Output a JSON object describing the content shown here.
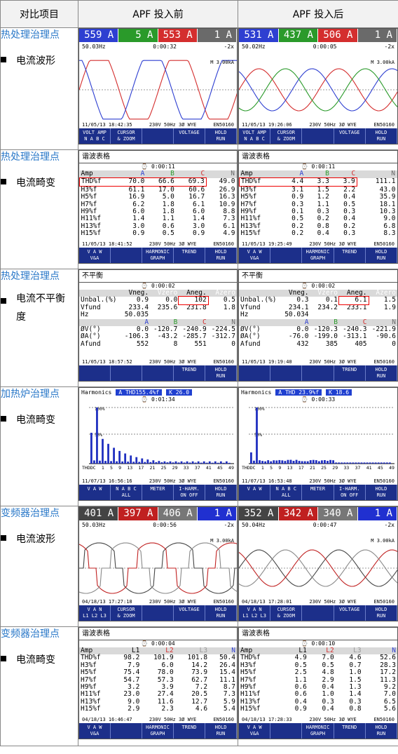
{
  "header": {
    "col1": "对比项目",
    "col2": "APF 投入前",
    "col3": "APF 投入后"
  },
  "rows": [
    {
      "title": "热处理治理点",
      "desc": "电流波形"
    },
    {
      "title": "热处理治理点",
      "desc": "电流畸变"
    },
    {
      "title": "热处理治理点",
      "desc": "电流不平衡度"
    },
    {
      "title": "加热炉治理点",
      "desc": "电流畸变"
    },
    {
      "title": "变频器治理点",
      "desc": "电流波形"
    },
    {
      "title": "变频器治理点",
      "desc": "电流畸变"
    }
  ],
  "wave1": {
    "before": {
      "readings": [
        "559 A",
        "5 A",
        "553 A",
        "1 A"
      ],
      "range": "50.03Hz",
      "time": "0:00:32",
      "scale": "M 3.00kA",
      "date": "11/05/13 18:42:35",
      "sys": "230V 50Hz 3Ø WYE",
      "model": "EN50160",
      "keys": [
        "VOLT AMP\nN A B C",
        "CURSOR\n& ZOOM",
        "",
        "VOLTAGE",
        "HOLD\nRUN"
      ]
    },
    "after": {
      "readings": [
        "531 A",
        "437 A",
        "506 A",
        "1 A"
      ],
      "range": "50.02Hz",
      "time": "0:00:05",
      "scale": "M 3.00kA",
      "date": "11/05/13 19:26:06",
      "sys": "230V 50Hz 3Ø WYE",
      "model": "EN50160",
      "keys": [
        "VOLT AMP\nN A B C",
        "CURSOR\n& ZOOM",
        "",
        "VOLTAGE",
        "HOLD\nRUN"
      ]
    }
  },
  "harm1": {
    "before": {
      "title": "谐波表格",
      "time": "0:00:11",
      "cols": [
        "Amp",
        "A",
        "B",
        "C",
        "N"
      ],
      "rows": [
        [
          "THD%f",
          "70.0",
          "66.6",
          "69.3",
          "49.0"
        ],
        [
          "H3%f",
          "61.1",
          "17.0",
          "60.6",
          "26.9"
        ],
        [
          "H5%f",
          "16.9",
          "5.0",
          "16.7",
          "16.3"
        ],
        [
          "H7%f",
          "6.2",
          "1.8",
          "6.1",
          "10.9"
        ],
        [
          "H9%f",
          "6.0",
          "1.8",
          "6.0",
          "8.8"
        ],
        [
          "H11%f",
          "1.4",
          "1.1",
          "1.4",
          "7.3"
        ],
        [
          "H13%f",
          "3.0",
          "0.6",
          "3.0",
          "6.1"
        ],
        [
          "H15%f",
          "0.9",
          "0.5",
          "0.9",
          "4.9"
        ]
      ],
      "date": "11/05/13 18:41:52",
      "sys": "230V 50Hz 3Ø WYE",
      "model": "EN50160",
      "keys": [
        "V A W\nV&A",
        "",
        "HARMONIC\nGRAPH",
        "TREND",
        "HOLD\nRUN"
      ]
    },
    "after": {
      "title": "谐波表格",
      "time": "0:00:11",
      "cols": [
        "Amp",
        "A",
        "B",
        "C",
        "N"
      ],
      "rows": [
        [
          "THD%f",
          "4.4",
          "3.3",
          "3.9",
          "111.1"
        ],
        [
          "H3%f",
          "3.1",
          "1.5",
          "2.2",
          "43.0"
        ],
        [
          "H5%f",
          "0.9",
          "1.2",
          "0.4",
          "35.9"
        ],
        [
          "H7%f",
          "0.3",
          "1.1",
          "0.5",
          "18.1"
        ],
        [
          "H9%f",
          "0.1",
          "0.3",
          "0.3",
          "10.3"
        ],
        [
          "H11%f",
          "0.5",
          "0.2",
          "0.4",
          "9.0"
        ],
        [
          "H13%f",
          "0.2",
          "0.8",
          "0.2",
          "6.8"
        ],
        [
          "H15%f",
          "0.2",
          "0.4",
          "0.3",
          "8.3"
        ]
      ],
      "date": "11/05/13 19:25:49",
      "sys": "230V 50Hz 3Ø WYE",
      "model": "EN50160",
      "keys": [
        "V A W\nV&A",
        "",
        "HARMONIC\nGRAPH",
        "TREND",
        "HOLD\nRUN"
      ]
    }
  },
  "unbal": {
    "before": {
      "title": "不平衡",
      "time": "0:00:02",
      "head": [
        "",
        "Vneg.",
        "Vzero",
        "Aneg.",
        "Azero"
      ],
      "unbal": [
        "Unbal.(%)",
        "0.9",
        "0.0",
        "102",
        "0.5"
      ],
      "vfund": [
        "Vfund",
        "233.4",
        "235.6",
        "231.8",
        "1.8"
      ],
      "hz": [
        "Hz",
        "50.035"
      ],
      "abc": [
        "",
        "A",
        "B",
        "C",
        "N"
      ],
      "phv": [
        "ØV(°)",
        "0.0",
        "-120.7",
        "-240.9",
        "-224.5"
      ],
      "pha": [
        "ØA(°)",
        "-106.3",
        "-43.2",
        "-285.7",
        "-312.7"
      ],
      "afund": [
        "Afund",
        "552",
        "8",
        "551",
        "0"
      ],
      "date": "11/05/13 18:57:52",
      "sys": "230V 50Hz 3Ø WYE",
      "model": "EN50160",
      "keys": [
        "",
        "",
        "",
        "TREND",
        "HOLD\nRUN"
      ]
    },
    "after": {
      "title": "不平衡",
      "time": "0:00:02",
      "head": [
        "",
        "Vneg.",
        "Vzero",
        "Aneg.",
        "Azero"
      ],
      "unbal": [
        "Unbal.(%)",
        "0.3",
        "0.1",
        "6.1",
        "1.5"
      ],
      "vfund": [
        "Vfund",
        "234.1",
        "234.2",
        "233.1",
        "1.9"
      ],
      "hz": [
        "Hz",
        "50.034"
      ],
      "abc": [
        "",
        "A",
        "B",
        "C",
        "N"
      ],
      "phv": [
        "ØV(°)",
        "0.0",
        "-120.3",
        "-240.3",
        "-221.9"
      ],
      "pha": [
        "ØA(°)",
        "-76.0",
        "-199.0",
        "-313.1",
        "-90.6"
      ],
      "afund": [
        "Afund",
        "432",
        "385",
        "405",
        "0"
      ],
      "date": "11/05/13 19:19:40",
      "sys": "230V 50Hz 3Ø WYE",
      "model": "EN50160",
      "keys": [
        "",
        "",
        "",
        "TREND",
        "HOLD\nRUN"
      ]
    }
  },
  "spec": {
    "before": {
      "title": "Harmonics",
      "badge": "A THD155.4%f",
      "k": "K 26.0",
      "time": "0:01:34",
      "p100": "100%",
      "p50": "50%",
      "xlabels": [
        "THDDC",
        "1",
        "5",
        "9",
        "13",
        "17",
        "21",
        "25",
        "29",
        "33",
        "37",
        "41",
        "45",
        "49"
      ],
      "date": "11/07/13 16:56:16",
      "sys": "230V 50Hz 3Ø WYE",
      "model": "EN50160",
      "keys": [
        "V A W",
        "N A B C\nALL",
        "METER",
        "I-HARM.\nON OFF",
        "HOLD\nRUN"
      ]
    },
    "after": {
      "title": "Harmonics",
      "badge": "A THD 23.9%f",
      "k": "K 18.6",
      "time": "0:00:33",
      "p100": "100%",
      "p50": "50%",
      "xlabels": [
        "THDDC",
        "1",
        "5",
        "9",
        "13",
        "17",
        "21",
        "25",
        "29",
        "33",
        "37",
        "41",
        "45",
        "49"
      ],
      "date": "11/07/13 16:53:48",
      "sys": "230V 50Hz 3Ø WYE",
      "model": "EN50160",
      "keys": [
        "V A W",
        "N A B C\nALL",
        "METER",
        "I-HARM.\nON OFF",
        "HOLD\nRUN"
      ]
    }
  },
  "wave2": {
    "before": {
      "readings": [
        "401 A",
        "397 A",
        "406 A",
        "1 A"
      ],
      "range": "50.03Hz",
      "time": "0:00:56",
      "scale": "M 3.00kA",
      "date": "04/18/13 17:27:18",
      "sys": "230V 50Hz 3Ø WYE",
      "model": "EN50160",
      "keys": [
        "V A N\nL1 L2 L3",
        "CURSOR\n& ZOOM",
        "",
        "VOLTAGE",
        "HOLD\nRUN"
      ]
    },
    "after": {
      "readings": [
        "352 A",
        "342 A",
        "340 A",
        "1 A"
      ],
      "range": "50.04Hz",
      "time": "0:00:47",
      "scale": "M 3.00kA",
      "date": "04/18/13 17:28:01",
      "sys": "230V 50Hz 3Ø WYE",
      "model": "EN50160",
      "keys": [
        "V A N\nL1 L2 L3",
        "CURSOR\n& ZOOM",
        "",
        "VOLTAGE",
        "HOLD\nRUN"
      ]
    }
  },
  "harm2": {
    "before": {
      "title": "谐波表格",
      "time": "0:00:04",
      "cols": [
        "Amp",
        "L1",
        "L2",
        "L3",
        "N"
      ],
      "rows": [
        [
          "THD%f",
          "98.2",
          "101.9",
          "101.8",
          "50.4"
        ],
        [
          "H3%f",
          "7.9",
          "6.0",
          "14.2",
          "26.4"
        ],
        [
          "H5%f",
          "75.4",
          "78.0",
          "73.9",
          "15.4"
        ],
        [
          "H7%f",
          "54.7",
          "57.3",
          "62.7",
          "11.1"
        ],
        [
          "H9%f",
          "3.2",
          "3.9",
          "7.2",
          "8.7"
        ],
        [
          "H11%f",
          "23.0",
          "27.4",
          "20.5",
          "7.3"
        ],
        [
          "H13%f",
          "9.0",
          "11.6",
          "12.7",
          "5.9"
        ],
        [
          "H15%f",
          "2.9",
          "2.3",
          "4.6",
          "5.4"
        ]
      ],
      "date": "04/18/13 16:46:47",
      "sys": "230V 50Hz 3Ø WYE",
      "model": "EN50160",
      "keys": [
        "V A W\nV&A",
        "",
        "HARMONIC\nGRAPH",
        "TREND",
        "HOLD\nRUN"
      ]
    },
    "after": {
      "title": "谐波表格",
      "time": "0:00:10",
      "cols": [
        "Amp",
        "L1",
        "L2",
        "L3",
        "N"
      ],
      "rows": [
        [
          "THD%f",
          "4.9",
          "7.0",
          "4.6",
          "52.6"
        ],
        [
          "H3%f",
          "0.5",
          "0.5",
          "0.7",
          "28.3"
        ],
        [
          "H5%f",
          "2.5",
          "4.8",
          "1.0",
          "17.2"
        ],
        [
          "H7%f",
          "1.1",
          "2.9",
          "1.5",
          "11.3"
        ],
        [
          "H9%f",
          "0.6",
          "0.4",
          "1.3",
          "9.2"
        ],
        [
          "H11%f",
          "0.6",
          "1.0",
          "1.4",
          "7.0"
        ],
        [
          "H13%f",
          "0.4",
          "0.3",
          "0.3",
          "6.5"
        ],
        [
          "H15%f",
          "0.9",
          "0.4",
          "0.8",
          "5.6"
        ]
      ],
      "date": "04/18/13 17:28:33",
      "sys": "230V 50Hz 3Ø WYE",
      "model": "EN50160",
      "keys": [
        "V A W\nV&A",
        "",
        "HARMONIC\nGRAPH",
        "TREND",
        "HOLD\nRUN"
      ]
    }
  },
  "colors": {
    "a": "#2e3fd1",
    "b": "#2a9a2a",
    "c": "#d42e2e",
    "n": "#6a6a6a",
    "hl": "#e00000",
    "key": "#1c2f8a"
  }
}
